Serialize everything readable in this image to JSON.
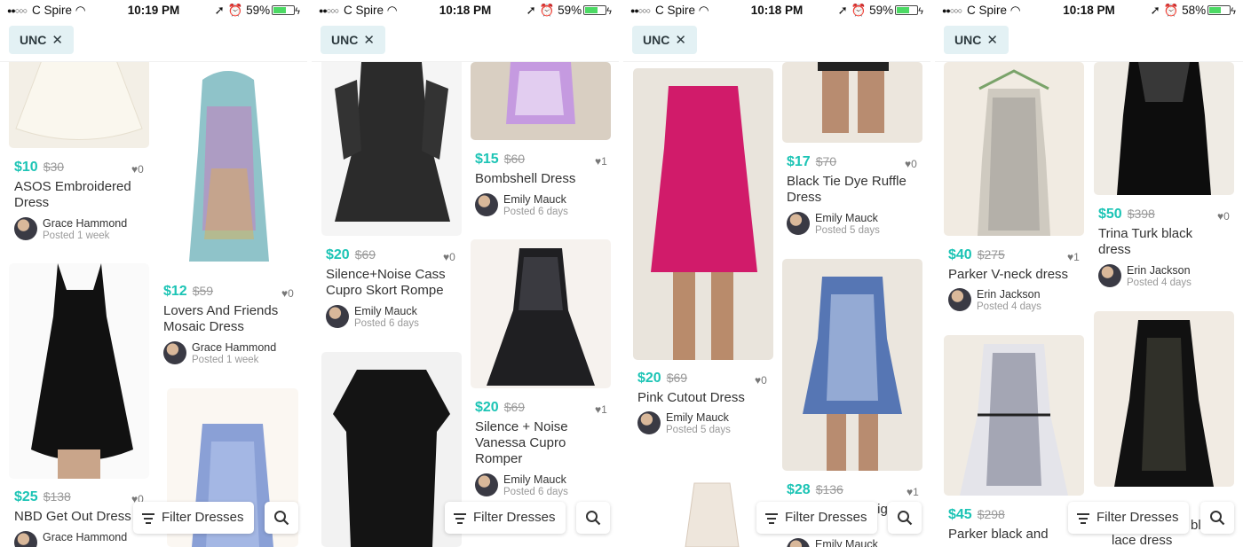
{
  "chip_label": "UNC",
  "filter_label": "Filter Dresses",
  "panels": [
    {
      "status": {
        "carrier": "C Spire",
        "time": "10:19 PM",
        "battery": "59%"
      },
      "items": [
        {
          "price": "$10",
          "original": "$30",
          "likes": "0",
          "title": [
            "ASOS Embroidered",
            "Dress"
          ],
          "seller": "Grace Hammond",
          "posted": "Posted 1 week"
        },
        {
          "price": "$12",
          "original": "$59",
          "likes": "0",
          "title": [
            "Lovers And Friends",
            "Mosaic Dress"
          ],
          "seller": "Grace Hammond",
          "posted": "Posted 1 week"
        },
        {
          "price": "$25",
          "original": "$138",
          "likes": "0",
          "title": [
            "NBD Get Out Dress"
          ],
          "seller": "Grace Hammond",
          "posted": ""
        }
      ]
    },
    {
      "status": {
        "carrier": "C Spire",
        "time": "10:18 PM",
        "battery": "59%"
      },
      "items": [
        {
          "price": "$15",
          "original": "$60",
          "likes": "1",
          "title": [
            "Bombshell Dress"
          ],
          "seller": "Emily Mauck",
          "posted": "Posted 6 days"
        },
        {
          "price": "$20",
          "original": "$69",
          "likes": "0",
          "title": [
            "Silence+Noise Cass",
            "Cupro Skort Rompe"
          ],
          "seller": "Emily Mauck",
          "posted": "Posted 6 days"
        },
        {
          "price": "$20",
          "original": "$69",
          "likes": "1",
          "title": [
            "Silence + Noise",
            "Vanessa Cupro",
            "Romper"
          ],
          "seller": "Emily Mauck",
          "posted": "Posted 6 days"
        }
      ]
    },
    {
      "status": {
        "carrier": "C Spire",
        "time": "10:18 PM",
        "battery": "59%"
      },
      "items": [
        {
          "price": "$17",
          "original": "$70",
          "likes": "0",
          "title": [
            "Black Tie Dye Ruffle",
            "Dress"
          ],
          "seller": "Emily Mauck",
          "posted": "Posted 5 days"
        },
        {
          "price": "$20",
          "original": "$69",
          "likes": "0",
          "title": [
            "Pink Cutout Dress"
          ],
          "seller": "Emily Mauck",
          "posted": "Posted 5 days"
        },
        {
          "price": "$28",
          "original": "$136",
          "likes": "1",
          "title": [
            "tig"
          ],
          "seller": "Emily Mauck",
          "posted": ""
        }
      ]
    },
    {
      "status": {
        "carrier": "C Spire",
        "time": "10:18 PM",
        "battery": "58%"
      },
      "items": [
        {
          "price": "$40",
          "original": "$275",
          "likes": "1",
          "title": [
            "Parker V-neck dress"
          ],
          "seller": "Erin Jackson",
          "posted": "Posted 4 days"
        },
        {
          "price": "$50",
          "original": "$398",
          "likes": "0",
          "title": [
            "Trina Turk black",
            "dress"
          ],
          "seller": "Erin Jackson",
          "posted": "Posted 4 days"
        },
        {
          "price": "$45",
          "original": "$298",
          "likes": "",
          "title": [
            "Parker black and",
            "bl",
            "lace dress"
          ],
          "seller": "",
          "posted": ""
        }
      ]
    }
  ]
}
